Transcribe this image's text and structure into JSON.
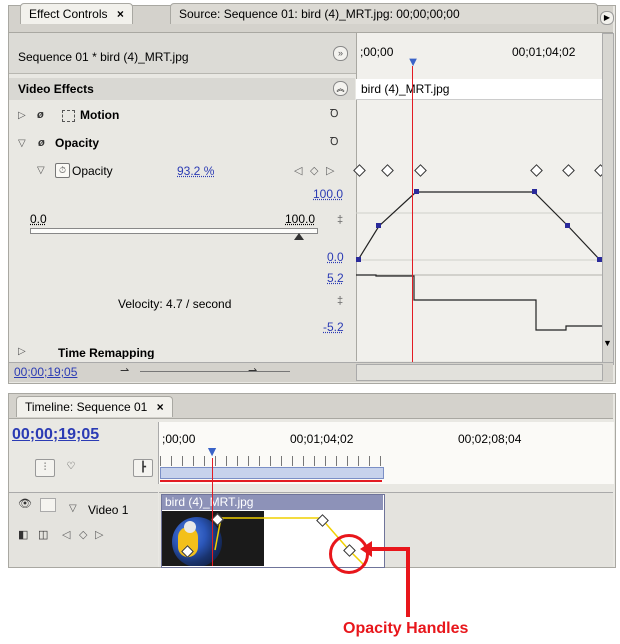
{
  "effect_panel": {
    "tab_effect_controls": "Effect Controls",
    "tab_close": "×",
    "tab_source": "Source: Sequence 01: bird (4)_MRT.jpg: 00;00;00;00",
    "sequence_label": "Sequence 01 * bird (4)_MRT.jpg",
    "ruler_start": ";00;00",
    "ruler_end": "00;01;04;02",
    "clip_name": "bird (4)_MRT.jpg",
    "video_effects_label": "Video Effects",
    "motion_label": "Motion",
    "opacity_section_label": "Opacity",
    "opacity_param_label": "Opacity",
    "opacity_value": "93.2 %",
    "graph_max": "100.0",
    "graph_min": "0.0",
    "slider_min": "0.0",
    "slider_max": "100.0",
    "velocity_top": "5.2",
    "velocity_bottom": "-5.2",
    "velocity_text": "Velocity: 4.7 / second",
    "time_remapping_label": "Time Remapping",
    "current_time": "00;00;19;05"
  },
  "timeline_panel": {
    "tab_label": "Timeline: Sequence 01",
    "tab_close": "×",
    "timecode": "00;00;19;05",
    "ruler_labels": [
      ";00;00",
      "00;01;04;02",
      "00;02;08;04"
    ],
    "track_name": "Video 1",
    "clip_name": "bird (4)_MRT.jpg"
  },
  "annotation": {
    "label": "Opacity Handles",
    "color": "#e8161b"
  },
  "colors": {
    "playhead": "#e31b23",
    "graph_point": "#2a2a9a",
    "accent_blue": "#2b3bb4",
    "clip_header": "#8d92b8"
  }
}
